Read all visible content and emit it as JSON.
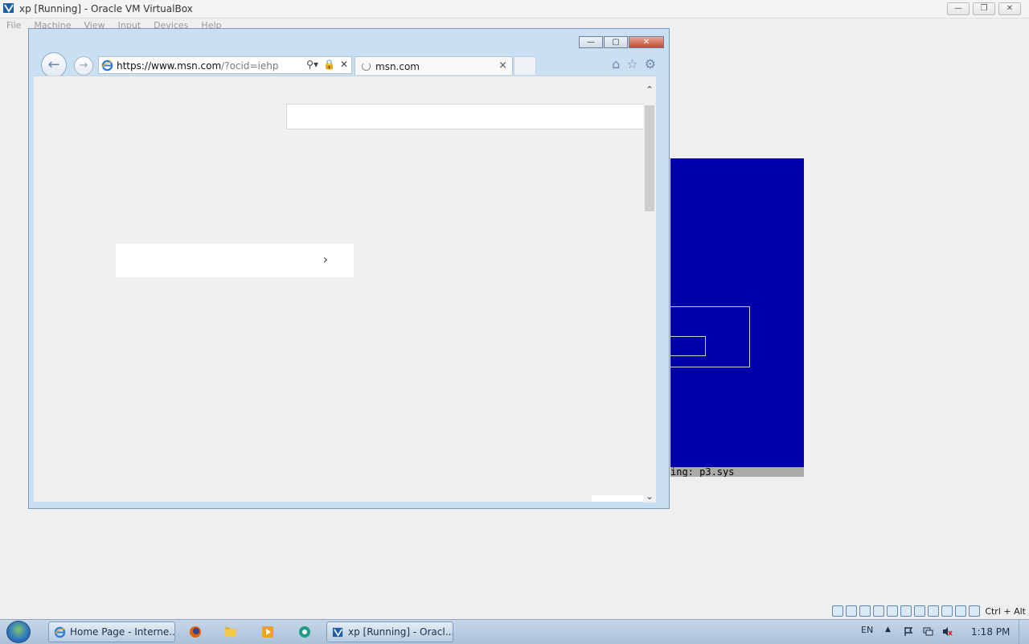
{
  "host": {
    "title": "xp [Running] - Oracle VM VirtualBox",
    "menu": [
      "File",
      "Machine",
      "View",
      "Input",
      "Devices",
      "Help"
    ],
    "host_key": "Ctrl + Alt"
  },
  "guest": {
    "status_text": "ing: p3.sys"
  },
  "browser": {
    "url_main": "https://www.msn.com",
    "url_rest": "/?ocid=iehp",
    "tab_label": "msn.com"
  },
  "taskbar": {
    "buttons": [
      {
        "label": "Home Page - Interne..."
      },
      {
        "label": "xp [Running] - Oracl..."
      }
    ],
    "lang": "EN",
    "time": "1:18 PM"
  },
  "colors": {
    "setup_blue": "#0000aa",
    "ie_frame": "#c9dff2"
  }
}
